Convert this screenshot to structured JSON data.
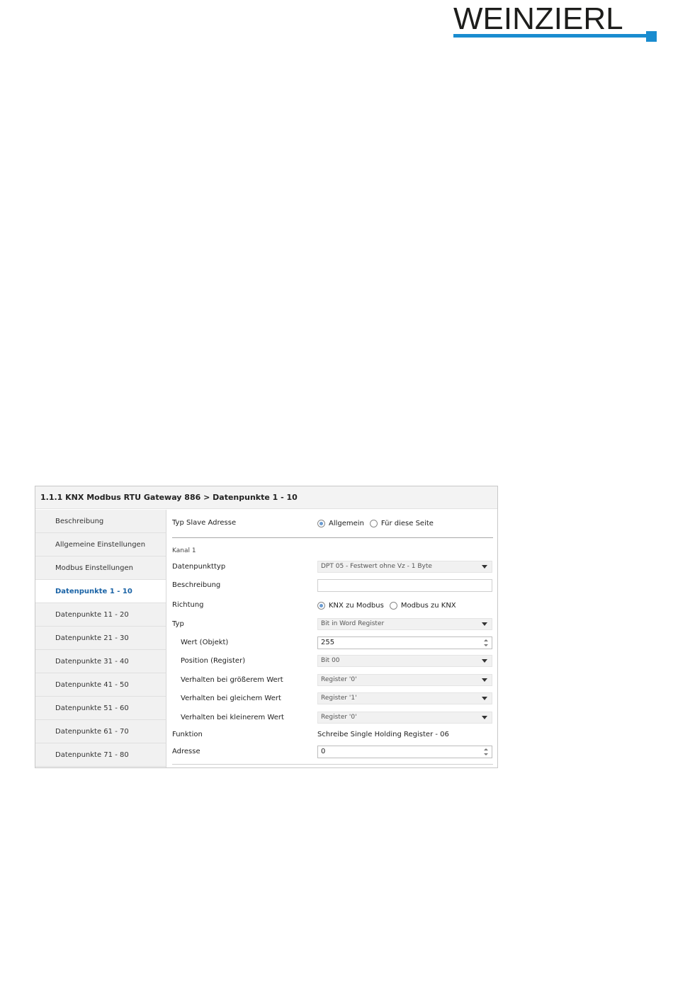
{
  "logo": {
    "text": "WEINZIERL"
  },
  "window": {
    "breadcrumb": "1.1.1 KNX Modbus RTU Gateway 886 > Datenpunkte 1 - 10"
  },
  "sidebar": {
    "items": [
      {
        "label": "Beschreibung"
      },
      {
        "label": "Allgemeine Einstellungen"
      },
      {
        "label": "Modbus Einstellungen"
      },
      {
        "label": "Datenpunkte 1 - 10"
      },
      {
        "label": "Datenpunkte 11 - 20"
      },
      {
        "label": "Datenpunkte 21 - 30"
      },
      {
        "label": "Datenpunkte 31 - 40"
      },
      {
        "label": "Datenpunkte 41 - 50"
      },
      {
        "label": "Datenpunkte 51 - 60"
      },
      {
        "label": "Datenpunkte 61 - 70"
      },
      {
        "label": "Datenpunkte 71 - 80"
      }
    ],
    "active": "Datenpunkte 1 - 10"
  },
  "form": {
    "slave_type": {
      "label": "Typ Slave Adresse",
      "options": [
        "Allgemein",
        "Für diese Seite"
      ],
      "selected": "Allgemein"
    },
    "channel_label": "Kanal 1",
    "datapoint_type": {
      "label": "Datenpunkttyp",
      "value": "DPT 05 - Festwert ohne Vz - 1 Byte"
    },
    "description": {
      "label": "Beschreibung",
      "value": ""
    },
    "direction": {
      "label": "Richtung",
      "options": [
        "KNX zu Modbus",
        "Modbus zu KNX"
      ],
      "selected": "KNX zu Modbus"
    },
    "type": {
      "label": "Typ",
      "value": "Bit in Word Register"
    },
    "value_object": {
      "label": "Wert (Objekt)",
      "value": "255"
    },
    "position_register": {
      "label": "Position (Register)",
      "value": "Bit 00"
    },
    "greater": {
      "label": "Verhalten bei größerem Wert",
      "value": "Register '0'"
    },
    "equal": {
      "label": "Verhalten bei gleichem Wert",
      "value": "Register '1'"
    },
    "smaller": {
      "label": "Verhalten bei kleinerem Wert",
      "value": "Register '0'"
    },
    "function": {
      "label": "Funktion",
      "value": "Schreibe Single Holding Register - 06"
    },
    "address": {
      "label": "Adresse",
      "value": "0"
    }
  },
  "colors": {
    "accent": "#1a8ccf",
    "active_nav": "#1a63a6"
  }
}
